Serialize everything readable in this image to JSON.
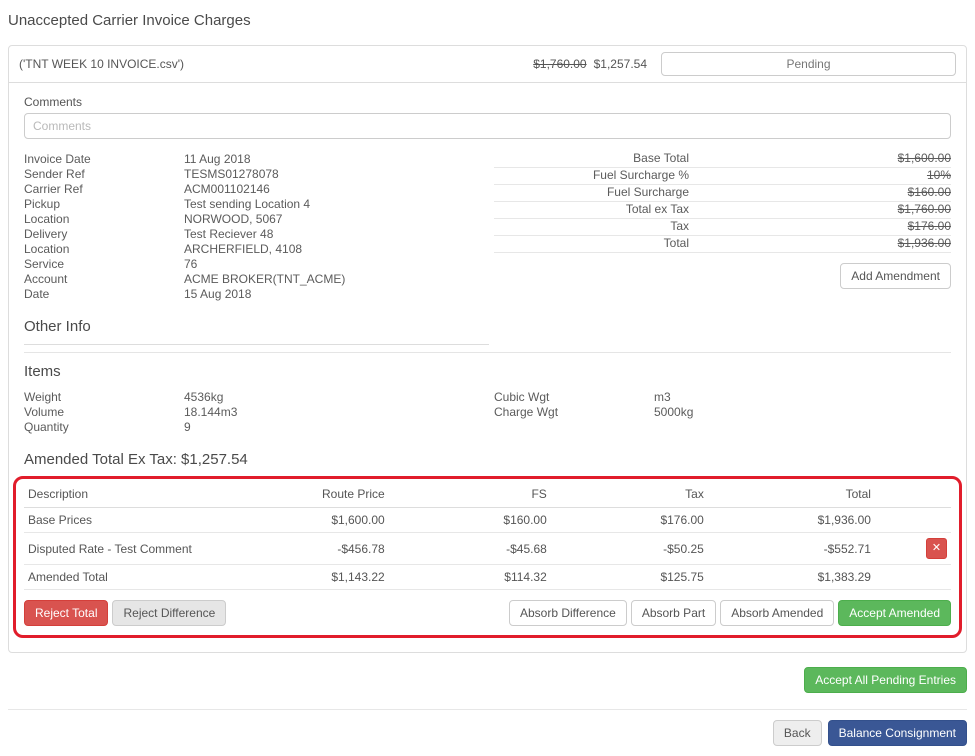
{
  "colors": {
    "annotation_red": "#e11d2b",
    "danger_red": "#d9534f",
    "success_green": "#5cb85c",
    "primary_blue": "#3a5795"
  },
  "page": {
    "title": "Unaccepted Carrier Invoice Charges"
  },
  "header": {
    "filename": "('TNT WEEK 10 INVOICE.csv')",
    "original_total": "$1,760.00",
    "current_total": "$1,257.54",
    "status": "Pending"
  },
  "comments": {
    "label": "Comments",
    "placeholder": "Comments"
  },
  "details": [
    {
      "label": "Invoice Date",
      "value": "11 Aug 2018"
    },
    {
      "label": "Sender Ref",
      "value": "TESMS01278078"
    },
    {
      "label": "Carrier Ref",
      "value": "ACM001102146"
    },
    {
      "label": "Pickup",
      "value": "Test sending Location 4"
    },
    {
      "label": "Location",
      "value": "NORWOOD, 5067"
    },
    {
      "label": "Delivery",
      "value": "Test Reciever 48"
    },
    {
      "label": "Location",
      "value": "ARCHERFIELD, 4108"
    },
    {
      "label": "Service",
      "value": "76"
    },
    {
      "label": "Account",
      "value": "ACME BROKER(TNT_ACME)"
    },
    {
      "label": "Date",
      "value": "15 Aug 2018"
    }
  ],
  "totals": {
    "rows": [
      {
        "label": "Base Total",
        "value": "$1,600.00"
      },
      {
        "label": "Fuel Surcharge %",
        "value": "10%"
      },
      {
        "label": "Fuel Surcharge",
        "value": "$160.00"
      },
      {
        "label": "Total ex Tax",
        "value": "$1,760.00"
      },
      {
        "label": "Tax",
        "value": "$176.00"
      },
      {
        "label": "Total",
        "value": "$1,936.00"
      }
    ],
    "add_amendment": "Add Amendment"
  },
  "sections": {
    "other_info": "Other Info",
    "items": "Items",
    "amended_total_heading": "Amended Total Ex Tax: $1,257.54"
  },
  "items": {
    "left": [
      {
        "label": "Weight",
        "value": "4536kg"
      },
      {
        "label": "Volume",
        "value": "18.144m3"
      },
      {
        "label": "Quantity",
        "value": "9"
      }
    ],
    "right": [
      {
        "label": "Cubic Wgt",
        "value": "m3"
      },
      {
        "label": "Charge Wgt",
        "value": "5000kg"
      }
    ]
  },
  "charges_table": {
    "headers": [
      "Description",
      "Route Price",
      "FS",
      "Tax",
      "Total"
    ],
    "rows": [
      {
        "description": "Base Prices",
        "route_price": "$1,600.00",
        "fs": "$160.00",
        "tax": "$176.00",
        "total": "$1,936.00"
      },
      {
        "description": "Disputed Rate - Test Comment",
        "route_price": "-$456.78",
        "fs": "-$45.68",
        "tax": "-$50.25",
        "total": "-$552.71"
      },
      {
        "description": "Amended Total",
        "route_price": "$1,143.22",
        "fs": "$114.32",
        "tax": "$125.75",
        "total": "$1,383.29"
      }
    ]
  },
  "actions": {
    "reject_total": "Reject Total",
    "reject_difference": "Reject Difference",
    "absorb_difference": "Absorb Difference",
    "absorb_part": "Absorb Part",
    "absorb_amended": "Absorb Amended",
    "accept_amended": "Accept Amended"
  },
  "footer": {
    "accept_all": "Accept All Pending Entries",
    "back": "Back",
    "balance_consignment": "Balance Consignment"
  },
  "icons": {
    "delete_row": "✕"
  }
}
